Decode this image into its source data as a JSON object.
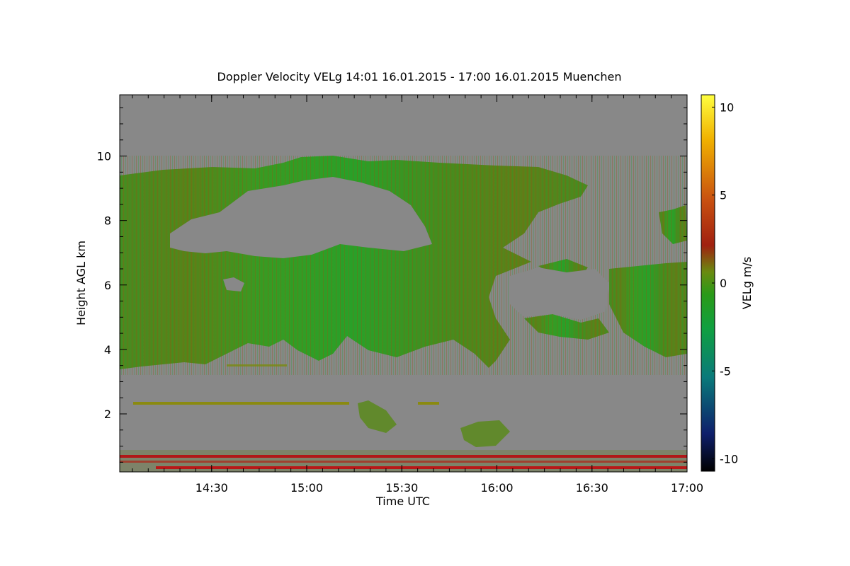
{
  "chart_data": {
    "type": "heatmap",
    "title": "Doppler Velocity VELg   14:01 16.01.2015 - 17:00 16.01.2015 Muenchen",
    "xlabel": "Time UTC",
    "ylabel": "Height AGL km",
    "colorbar_label": "VELg m/s",
    "x_ticks": [
      "14:30",
      "15:00",
      "15:30",
      "16:00",
      "16:30",
      "17:00"
    ],
    "x_tick_minutes": [
      29,
      59,
      89,
      119,
      149,
      179
    ],
    "xlim_minutes": [
      0,
      179
    ],
    "y_ticks": [
      2,
      4,
      6,
      8,
      10
    ],
    "ylim": [
      0.2,
      11.9
    ],
    "colorbar_ticks": [
      10,
      5,
      0,
      -5,
      -10
    ],
    "colorbar_range": [
      -10.7,
      10.7
    ],
    "colors": {
      "background_no_signal": "#888888",
      "colormap": [
        "#000000",
        "#0e1f6b",
        "#0a7a7a",
        "#10a040",
        "#2a9a18",
        "#6a8a10",
        "#a03010",
        "#c86010",
        "#ffd000",
        "#ffff40"
      ]
    },
    "cloud_layer": {
      "description_values": {
        "upper_top_km": 9.7,
        "base_km_range": [
          3.4,
          4.5
        ],
        "mean_velocity_ms": -1.0
      }
    },
    "near_ground_lines_km": [
      0.65,
      0.5,
      0.3
    ]
  }
}
